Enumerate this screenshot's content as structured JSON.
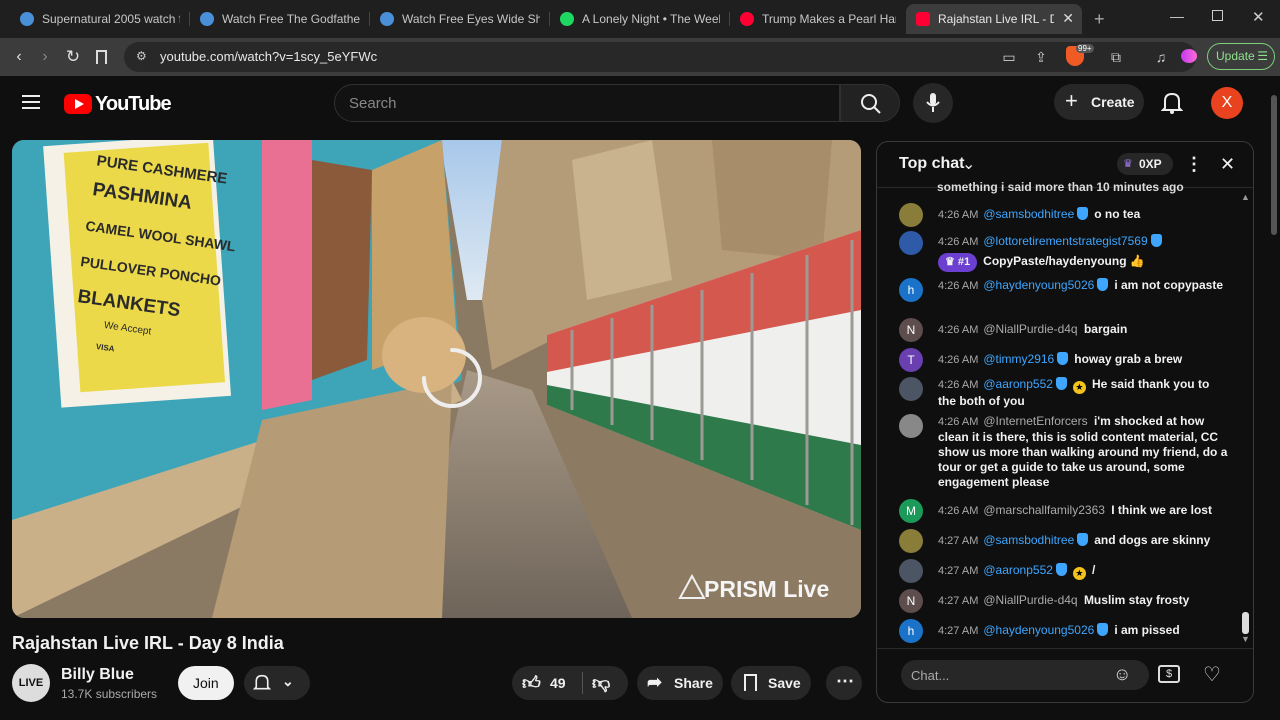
{
  "tabs": [
    {
      "title": "Supernatural 2005 watch fr",
      "fav": "#4a90d9"
    },
    {
      "title": "Watch Free The Godfather",
      "fav": "#4a90d9"
    },
    {
      "title": "Watch Free Eyes Wide Shut",
      "fav": "#4a90d9"
    },
    {
      "title": "A Lonely Night • The Week",
      "fav": "#1ed760"
    },
    {
      "title": "Trump Makes a Pearl Harb",
      "fav": "#ff0033"
    },
    {
      "title": "Rajahstan Live IRL - Da",
      "fav": "#ff0033"
    }
  ],
  "address": {
    "url": "youtube.com/watch?v=1scy_5eYFWc",
    "update_label": "Update",
    "brave_badge": "99+"
  },
  "header": {
    "logo_text": "YouTube",
    "search_placeholder": "Search",
    "create_label": "Create",
    "avatar_letter": "X"
  },
  "video": {
    "sign": [
      "PURE CASHMERE",
      "PASHMINA",
      "CAMEL WOOL SHAWL",
      "PULLOVER PONCHO",
      "BLANKETS",
      "We Accept",
      "VISA"
    ],
    "watermark": "PRISM Live"
  },
  "below": {
    "title": "Rajahstan Live IRL - Day 8 India",
    "channel": "Billy Blue",
    "subscribers": "13.7K subscribers",
    "channel_avatar_text": "LIVE",
    "join": "Join",
    "likes": "49",
    "share": "Share",
    "save": "Save"
  },
  "chat": {
    "header": "Top chat",
    "xp": "0XP",
    "top_cut": "something i said more than 10 minutes ago",
    "input_placeholder": "Chat...",
    "messages": [
      {
        "time": "4:26 AM",
        "author": "@samsbodhitree",
        "verified": true,
        "text": "o no tea",
        "avatar": "",
        "color": "#8a7d3a"
      },
      {
        "time": "4:26 AM",
        "author": "@lottoretirementstrategist7569",
        "verified": true,
        "rank": "#1",
        "text": "CopyPaste/haydenyoung 👍",
        "avatar": "",
        "color": "#2f5aa8"
      },
      {
        "time": "4:26 AM",
        "author": "@haydenyoung5026",
        "verified": true,
        "text": "i am not copypaste",
        "avatar": "h",
        "color": "#1a73c9"
      },
      {
        "time": "4:26 AM",
        "author": "@NiallPurdie-d4q",
        "verified": false,
        "text": "bargain",
        "avatar": "N",
        "color": "#5d4d4d"
      },
      {
        "time": "4:26 AM",
        "author": "@timmy2916",
        "verified": true,
        "text": "howay grab a brew",
        "avatar": "T",
        "color": "#6a3fb0"
      },
      {
        "time": "4:26 AM",
        "author": "@aaronp552",
        "verified": true,
        "star": true,
        "text": "He said thank you to the both of you",
        "avatar": "",
        "color": "#4b5563"
      },
      {
        "time": "4:26 AM",
        "author": "@InternetEnforcers",
        "verified": false,
        "text": "i'm shocked at how clean it is there, this is solid content material, CC show us more than walking around my friend, do a tour or get a guide to take us around, some engagement please",
        "avatar": "",
        "color": "#888"
      },
      {
        "time": "4:26 AM",
        "author": "@marschallfamily2363",
        "verified": false,
        "text": "I think we are lost",
        "avatar": "M",
        "color": "#1c9a5a"
      },
      {
        "time": "4:27 AM",
        "author": "@samsbodhitree",
        "verified": true,
        "text": "and dogs are skinny",
        "avatar": "",
        "color": "#8a7d3a"
      },
      {
        "time": "4:27 AM",
        "author": "@aaronp552",
        "verified": true,
        "star": true,
        "text": "/",
        "avatar": "",
        "color": "#4b5563"
      },
      {
        "time": "4:27 AM",
        "author": "@NiallPurdie-d4q",
        "verified": false,
        "text": "Muslim stay frosty",
        "avatar": "N",
        "color": "#5d4d4d"
      },
      {
        "time": "4:27 AM",
        "author": "@haydenyoung5026",
        "verified": true,
        "text": "i am pissed",
        "avatar": "h",
        "color": "#1a73c9"
      }
    ]
  }
}
